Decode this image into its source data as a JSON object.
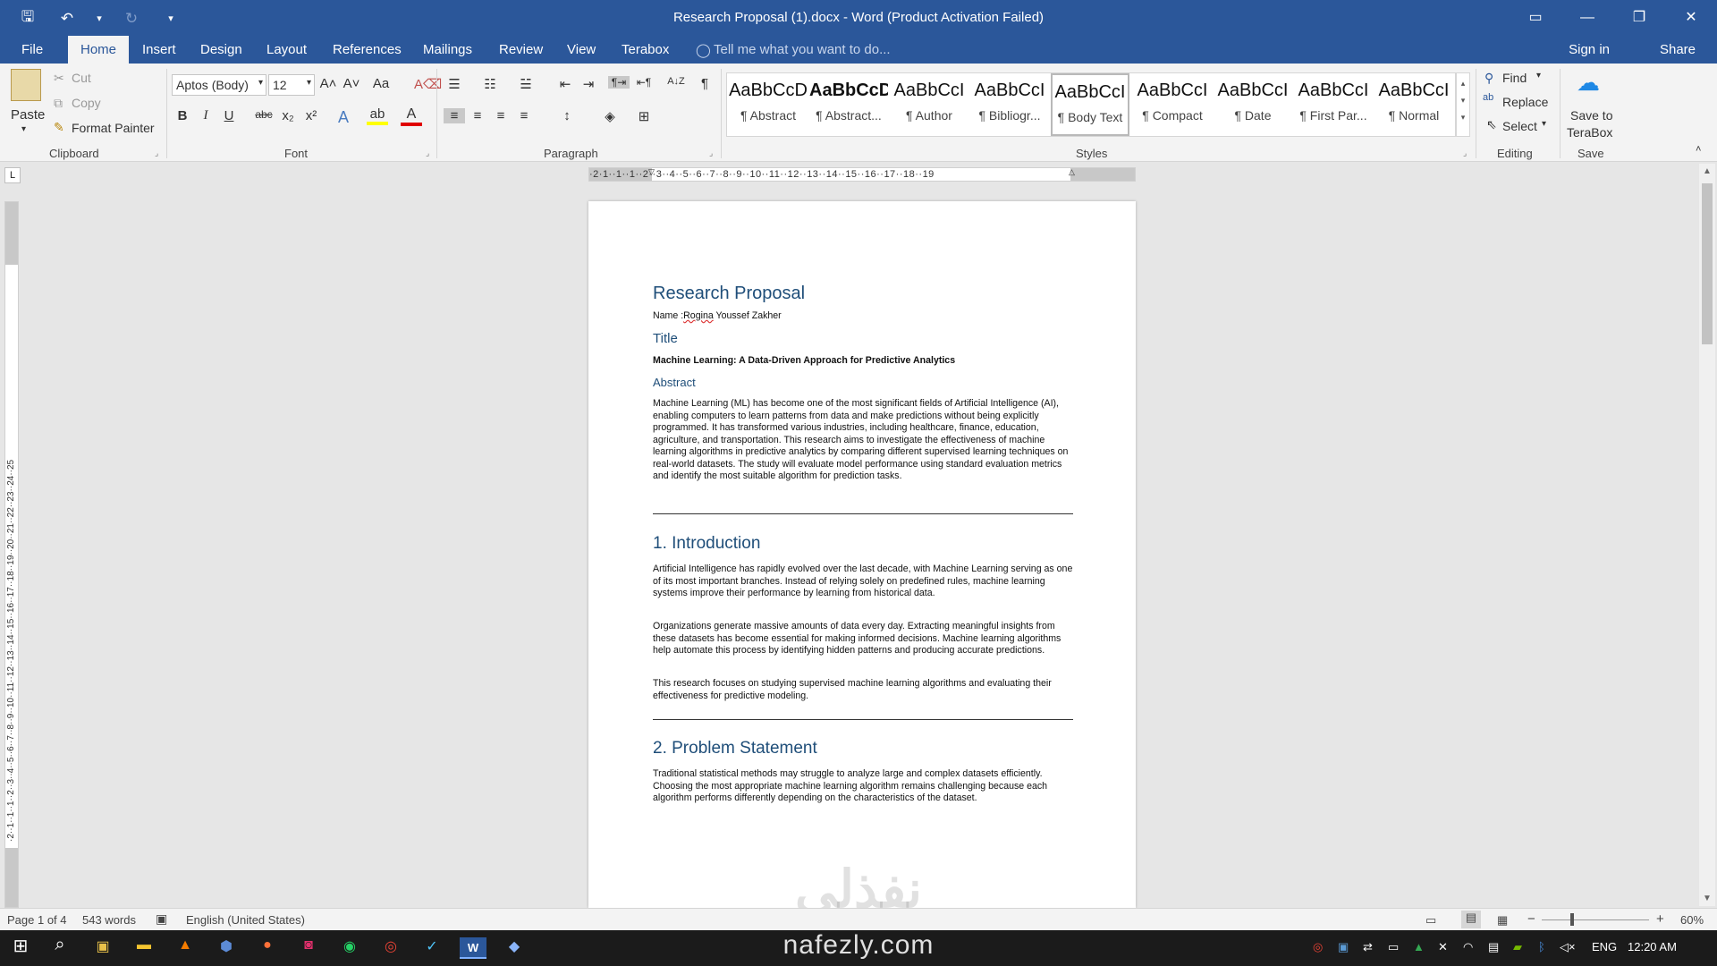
{
  "window": {
    "title": "Research Proposal (1).docx - Word (Product Activation Failed)",
    "qat": {
      "save": "🖫",
      "undo": "↶",
      "undo_menu": "▾",
      "redo": "↻",
      "customize": "▾"
    },
    "controls": {
      "ribbon_display": "▭",
      "minimize": "—",
      "restore": "❐",
      "close": "✕"
    }
  },
  "tabs": {
    "file": "File",
    "home": "Home",
    "insert": "Insert",
    "design": "Design",
    "layout": "Layout",
    "references": "References",
    "mailings": "Mailings",
    "review": "Review",
    "view": "View",
    "terabox": "Terabox"
  },
  "tell_me": {
    "icon": "lightbulb-icon",
    "placeholder": "Tell me what you want to do..."
  },
  "account": {
    "sign_in": "Sign in",
    "share": "Share"
  },
  "clipboard": {
    "paste": "Paste",
    "cut": "Cut",
    "copy": "Copy",
    "format_painter": "Format Painter",
    "label": "Clipboard"
  },
  "font": {
    "family": "Aptos (Body)",
    "size": "12",
    "label": "Font",
    "grow": "A˄",
    "shrink": "A˅",
    "case": "Aa",
    "clear": "A⌫",
    "bold": "B",
    "italic": "I",
    "underline": "U",
    "strike": "abc",
    "sub": "x₂",
    "sup": "x²",
    "effects": "A",
    "highlight": "ab",
    "color": "A"
  },
  "paragraph": {
    "label": "Paragraph",
    "bullets": "☰",
    "numbering": "☷",
    "multilevel": "☱",
    "decrease_indent": "⇤",
    "increase_indent": "⇥",
    "ltr": "¶⇥",
    "rtl": "⇤¶",
    "sort": "A↓Z",
    "show_marks": "¶",
    "align_left": "≡",
    "center": "≡",
    "align_right": "≡",
    "justify": "≡",
    "line_spacing": "↕",
    "shading": "◈",
    "borders": "⊞"
  },
  "styles": {
    "label": "Styles",
    "items": [
      {
        "preview": "AaBbCcD",
        "name": "¶ Abstract"
      },
      {
        "preview": "AaBbCcD",
        "name": "¶ Abstract..."
      },
      {
        "preview": "AaBbCcI",
        "name": "¶ Author"
      },
      {
        "preview": "AaBbCcI",
        "name": "¶ Bibliogr..."
      },
      {
        "preview": "AaBbCcI",
        "name": "¶ Body Text"
      },
      {
        "preview": "AaBbCcI",
        "name": "¶ Compact"
      },
      {
        "preview": "AaBbCcI",
        "name": "¶ Date"
      },
      {
        "preview": "AaBbCcI",
        "name": "¶ First Par..."
      },
      {
        "preview": "AaBbCcI",
        "name": "¶ Normal"
      }
    ],
    "selected_index": 4
  },
  "editing": {
    "label": "Editing",
    "find": "Find",
    "replace": "Replace",
    "select": "Select"
  },
  "save_group": {
    "label": "Save",
    "save_to": "Save to",
    "terabox": "TeraBox"
  },
  "ruler": {
    "horizontal": "·2·1··1··1··2··3··4··5··6··7··8··9··10··11··12··13··14··15··16··17··18··19",
    "vertical": "·2··1··1··1··2··3··4··5··6··7··8··9··10··11··12··13··14··15··16··17··18··19··20··21··22··23··24··25",
    "tab_selector": "L"
  },
  "document": {
    "heading": "Research Proposal",
    "name_label": "Name :",
    "name_first": "Rogina",
    "name_rest": " Youssef Zakher",
    "title_heading": "Title",
    "title_text": "Machine Learning: A Data-Driven Approach for Predictive Analytics",
    "abstract_heading": "Abstract",
    "abstract_text": "Machine Learning (ML) has become one of the most significant fields of Artificial Intelligence (AI), enabling computers to learn patterns from data and make predictions without being explicitly programmed. It has transformed various industries, including healthcare, finance, education, agriculture, and transportation. This research aims to investigate the effectiveness of machine learning algorithms in predictive analytics by comparing different supervised learning techniques on real-world datasets. The study will evaluate model performance using standard evaluation metrics and identify the most suitable algorithm for prediction tasks.",
    "intro_heading": "1. Introduction",
    "intro_p1": "Artificial Intelligence has rapidly evolved over the last decade, with Machine Learning serving as one of its most important branches. Instead of relying solely on predefined rules, machine learning systems improve their performance by learning from historical data.",
    "intro_p2": "Organizations generate massive amounts of data every day. Extracting meaningful insights from these datasets has become essential for making informed decisions. Machine learning algorithms help automate this process by identifying hidden patterns and producing accurate predictions.",
    "intro_p3": "This research focuses on studying supervised machine learning algorithms and evaluating their effectiveness for predictive modeling.",
    "problem_heading": "2. Problem Statement",
    "problem_text": "Traditional statistical methods may struggle to analyze large and complex datasets efficiently. Choosing the most appropriate machine learning algorithm remains challenging because each algorithm performs differently depending on the characteristics of the dataset."
  },
  "watermark": {
    "arabic": "نفذلي",
    "url": "nafezly.com"
  },
  "status": {
    "page": "Page 1 of 4",
    "words": "543 words",
    "proofing_icon": "book-check-icon",
    "language": "English (United States)",
    "zoom": "60%",
    "zoom_minus": "−",
    "zoom_plus": "+"
  },
  "taskbar": {
    "start": "⊞",
    "search": "⌕",
    "apps": [
      "store-icon",
      "file-explorer-icon",
      "vlc-icon",
      "shield-icon",
      "firefox-icon",
      "instagram-icon",
      "whatsapp-icon",
      "chrome-icon",
      "vscode-icon",
      "word-icon",
      "maps-icon"
    ],
    "lang": "ENG",
    "time": "12:20 AM"
  },
  "colors": {
    "word_blue": "#2b579a",
    "heading_blue": "#1f4e79",
    "ribbon_bg": "#f3f3f3"
  }
}
